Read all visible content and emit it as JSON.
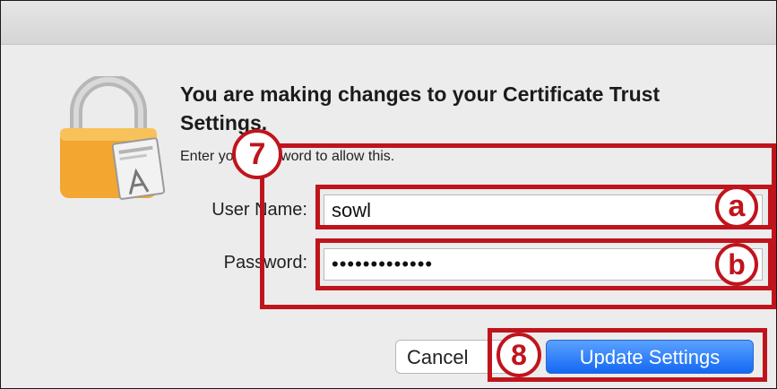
{
  "dialog": {
    "title": "You are making changes to your Certificate Trust Settings.",
    "subtitle": "Enter your password to allow this.",
    "icon": "padlock-with-certificate-icon"
  },
  "form": {
    "username_label": "User Name:",
    "username_value": "sowl",
    "password_label": "Password:",
    "password_value": "•••••••••••••"
  },
  "buttons": {
    "cancel": "Cancel",
    "update": "Update Settings"
  },
  "annotations": {
    "step_7": "7",
    "step_8": "8",
    "label_a": "a",
    "label_b": "b"
  },
  "colors": {
    "annotation_red": "#c0141c",
    "primary_button_blue": "#1468f3",
    "lock_gold": "#f3a630"
  }
}
